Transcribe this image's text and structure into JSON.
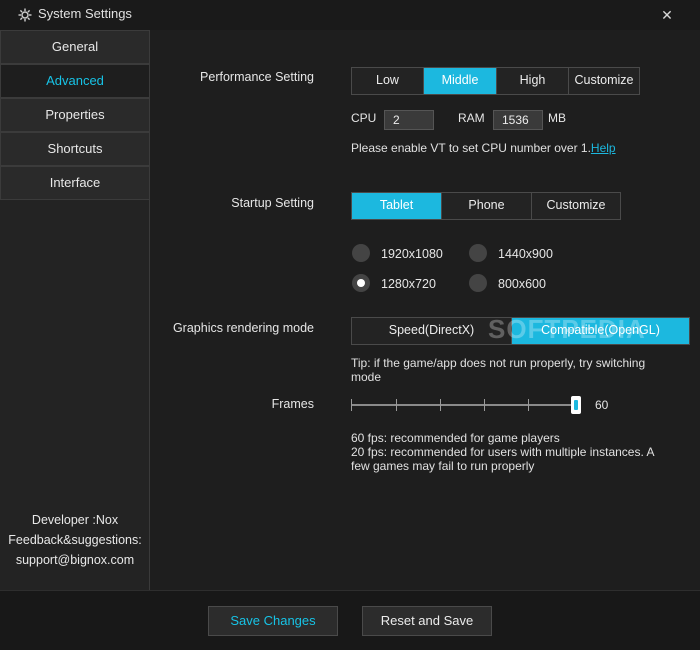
{
  "window": {
    "title": "System Settings",
    "close_glyph": "✕"
  },
  "sidebar": {
    "items": [
      {
        "label": "General",
        "active": false
      },
      {
        "label": "Advanced",
        "active": true
      },
      {
        "label": "Properties",
        "active": false
      },
      {
        "label": "Shortcuts",
        "active": false
      },
      {
        "label": "Interface",
        "active": false
      }
    ],
    "developer": "Developer :Nox",
    "feedback": "Feedback&suggestions:",
    "email": "support@bignox.com"
  },
  "performance": {
    "label": "Performance Setting",
    "options": [
      "Low",
      "Middle",
      "High",
      "Customize"
    ],
    "selected": "Middle",
    "cpu_label": "CPU",
    "cpu_value": "2",
    "ram_label": "RAM",
    "ram_value": "1536",
    "ram_unit": "MB",
    "vt_note": "Please enable VT to set CPU number over 1.",
    "help_link": "Help"
  },
  "startup": {
    "label": "Startup Setting",
    "options": [
      "Tablet",
      "Phone",
      "Customize"
    ],
    "selected": "Tablet",
    "resolutions": [
      "1920x1080",
      "1440x900",
      "1280x720",
      "800x600"
    ],
    "selected_resolution": "1280x720"
  },
  "graphics": {
    "label": "Graphics rendering mode",
    "options": [
      "Speed(DirectX)",
      "Compatible(OpenGL)"
    ],
    "selected": "Compatible(OpenGL)",
    "tip_line1": "Tip: if the game/app does not run properly, try switching",
    "tip_line2": "mode"
  },
  "frames": {
    "label": "Frames",
    "value": "60",
    "ticks": 6,
    "note_line1": "60 fps: recommended for game players",
    "note_line2": "20 fps: recommended for users with multiple instances. A",
    "note_line3": "few games may fail to run properly"
  },
  "watermark": "SOFTPEDIA",
  "footer": {
    "save_label": "Save Changes",
    "reset_label": "Reset and Save"
  },
  "colors": {
    "accent": "#1cb8df",
    "background": "#1e1e1e",
    "sidebar": "#2a2a2a"
  }
}
